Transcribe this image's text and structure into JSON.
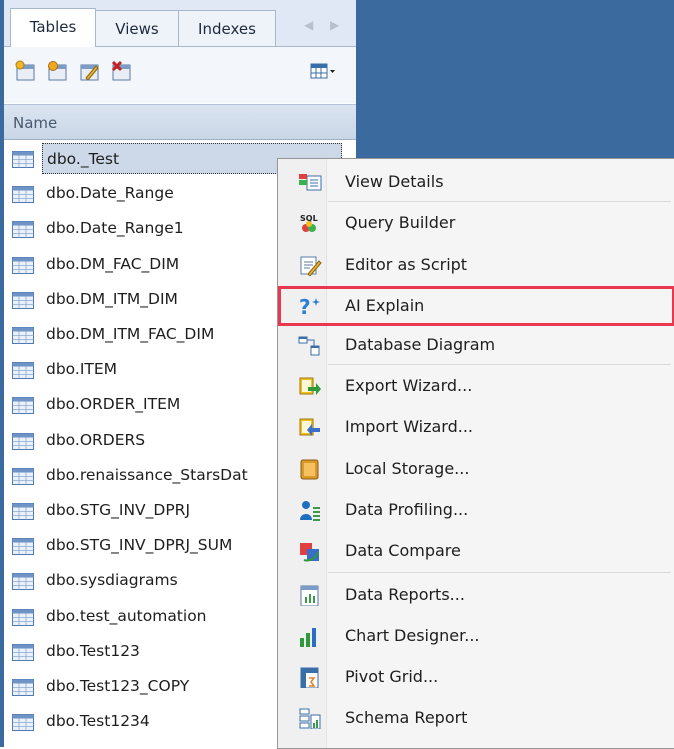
{
  "tabs": [
    {
      "label": "Tables",
      "active": true
    },
    {
      "label": "Views",
      "active": false
    },
    {
      "label": "Indexes",
      "active": false
    }
  ],
  "column_header": "Name",
  "tables": [
    "dbo._Test",
    "dbo.Date_Range",
    "dbo.Date_Range1",
    "dbo.DM_FAC_DIM",
    "dbo.DM_ITM_DIM",
    "dbo.DM_ITM_FAC_DIM",
    "dbo.ITEM",
    "dbo.ORDER_ITEM",
    "dbo.ORDERS",
    "dbo.renaissance_StarsDat",
    "dbo.STG_INV_DPRJ",
    "dbo.STG_INV_DPRJ_SUM",
    "dbo.sysdiagrams",
    "dbo.test_automation",
    "dbo.Test123",
    "dbo.Test123_COPY",
    "dbo.Test1234"
  ],
  "selected_table": "dbo._Test",
  "context_menu": [
    {
      "label": "View Details",
      "icon": "view-details-icon"
    },
    {
      "label": "Query Builder",
      "icon": "sql-query-icon"
    },
    {
      "label": "Editor as Script",
      "icon": "editor-script-icon"
    },
    {
      "label": "AI Explain",
      "icon": "ai-explain-icon",
      "highlighted": true
    },
    {
      "label": "Database Diagram",
      "icon": "database-diagram-icon"
    },
    {
      "label": "Export Wizard...",
      "icon": "export-wizard-icon"
    },
    {
      "label": "Import Wizard...",
      "icon": "import-wizard-icon"
    },
    {
      "label": "Local Storage...",
      "icon": "local-storage-icon"
    },
    {
      "label": "Data Profiling...",
      "icon": "data-profiling-icon"
    },
    {
      "label": "Data Compare",
      "icon": "data-compare-icon"
    },
    {
      "label": "Data Reports...",
      "icon": "data-reports-icon"
    },
    {
      "label": "Chart Designer...",
      "icon": "chart-designer-icon"
    },
    {
      "label": "Pivot Grid...",
      "icon": "pivot-grid-icon"
    },
    {
      "label": "Schema Report",
      "icon": "schema-report-icon"
    }
  ],
  "colors": {
    "workspace": "#3b6a9e",
    "highlight_border": "#e8384f",
    "selection": "#cdd9e8"
  }
}
